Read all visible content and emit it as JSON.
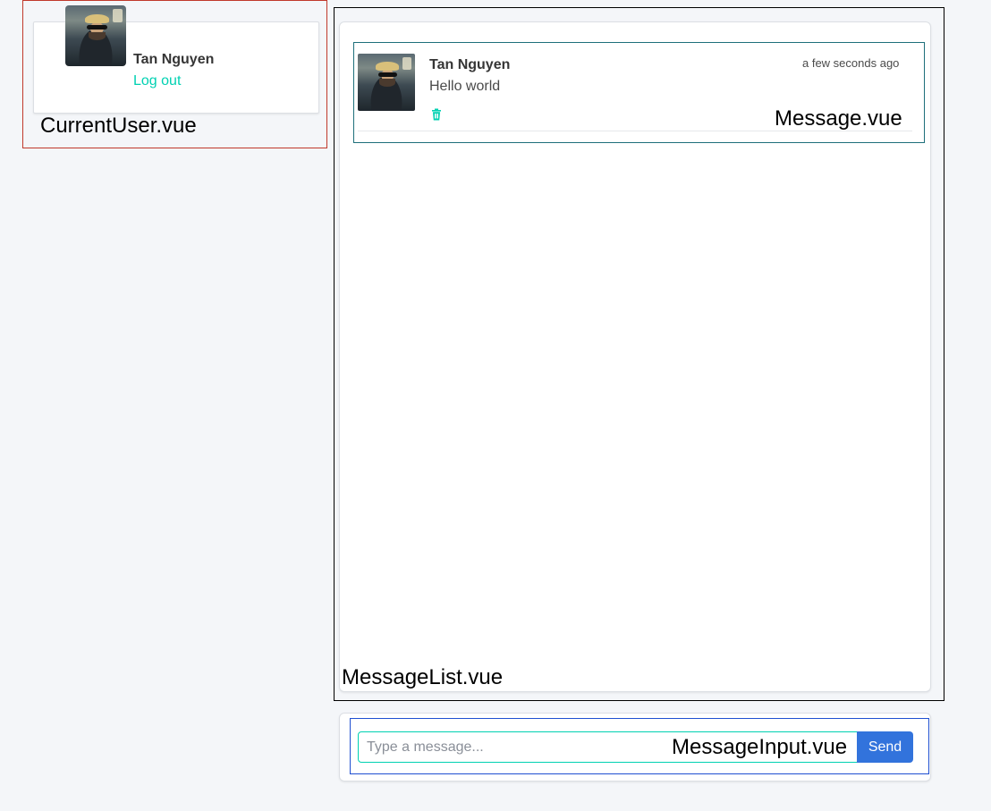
{
  "current_user": {
    "name": "Tan Nguyen",
    "logout_label": "Log out",
    "component_label": "CurrentUser.vue"
  },
  "message_list": {
    "component_label": "MessageList.vue",
    "messages": [
      {
        "author": "Tan Nguyen",
        "text": "Hello world",
        "time": "a few seconds ago",
        "component_label": "Message.vue"
      }
    ]
  },
  "message_input": {
    "placeholder": "Type a message...",
    "send_label": "Send",
    "component_label": "MessageInput.vue"
  },
  "colors": {
    "accent": "#00d1b2",
    "primary": "#3273dc",
    "current_user_outline": "#c0392b",
    "message_outline": "#1e6f7a",
    "input_outline": "#1f4fd1"
  },
  "icons": {
    "delete": "trash-icon"
  }
}
